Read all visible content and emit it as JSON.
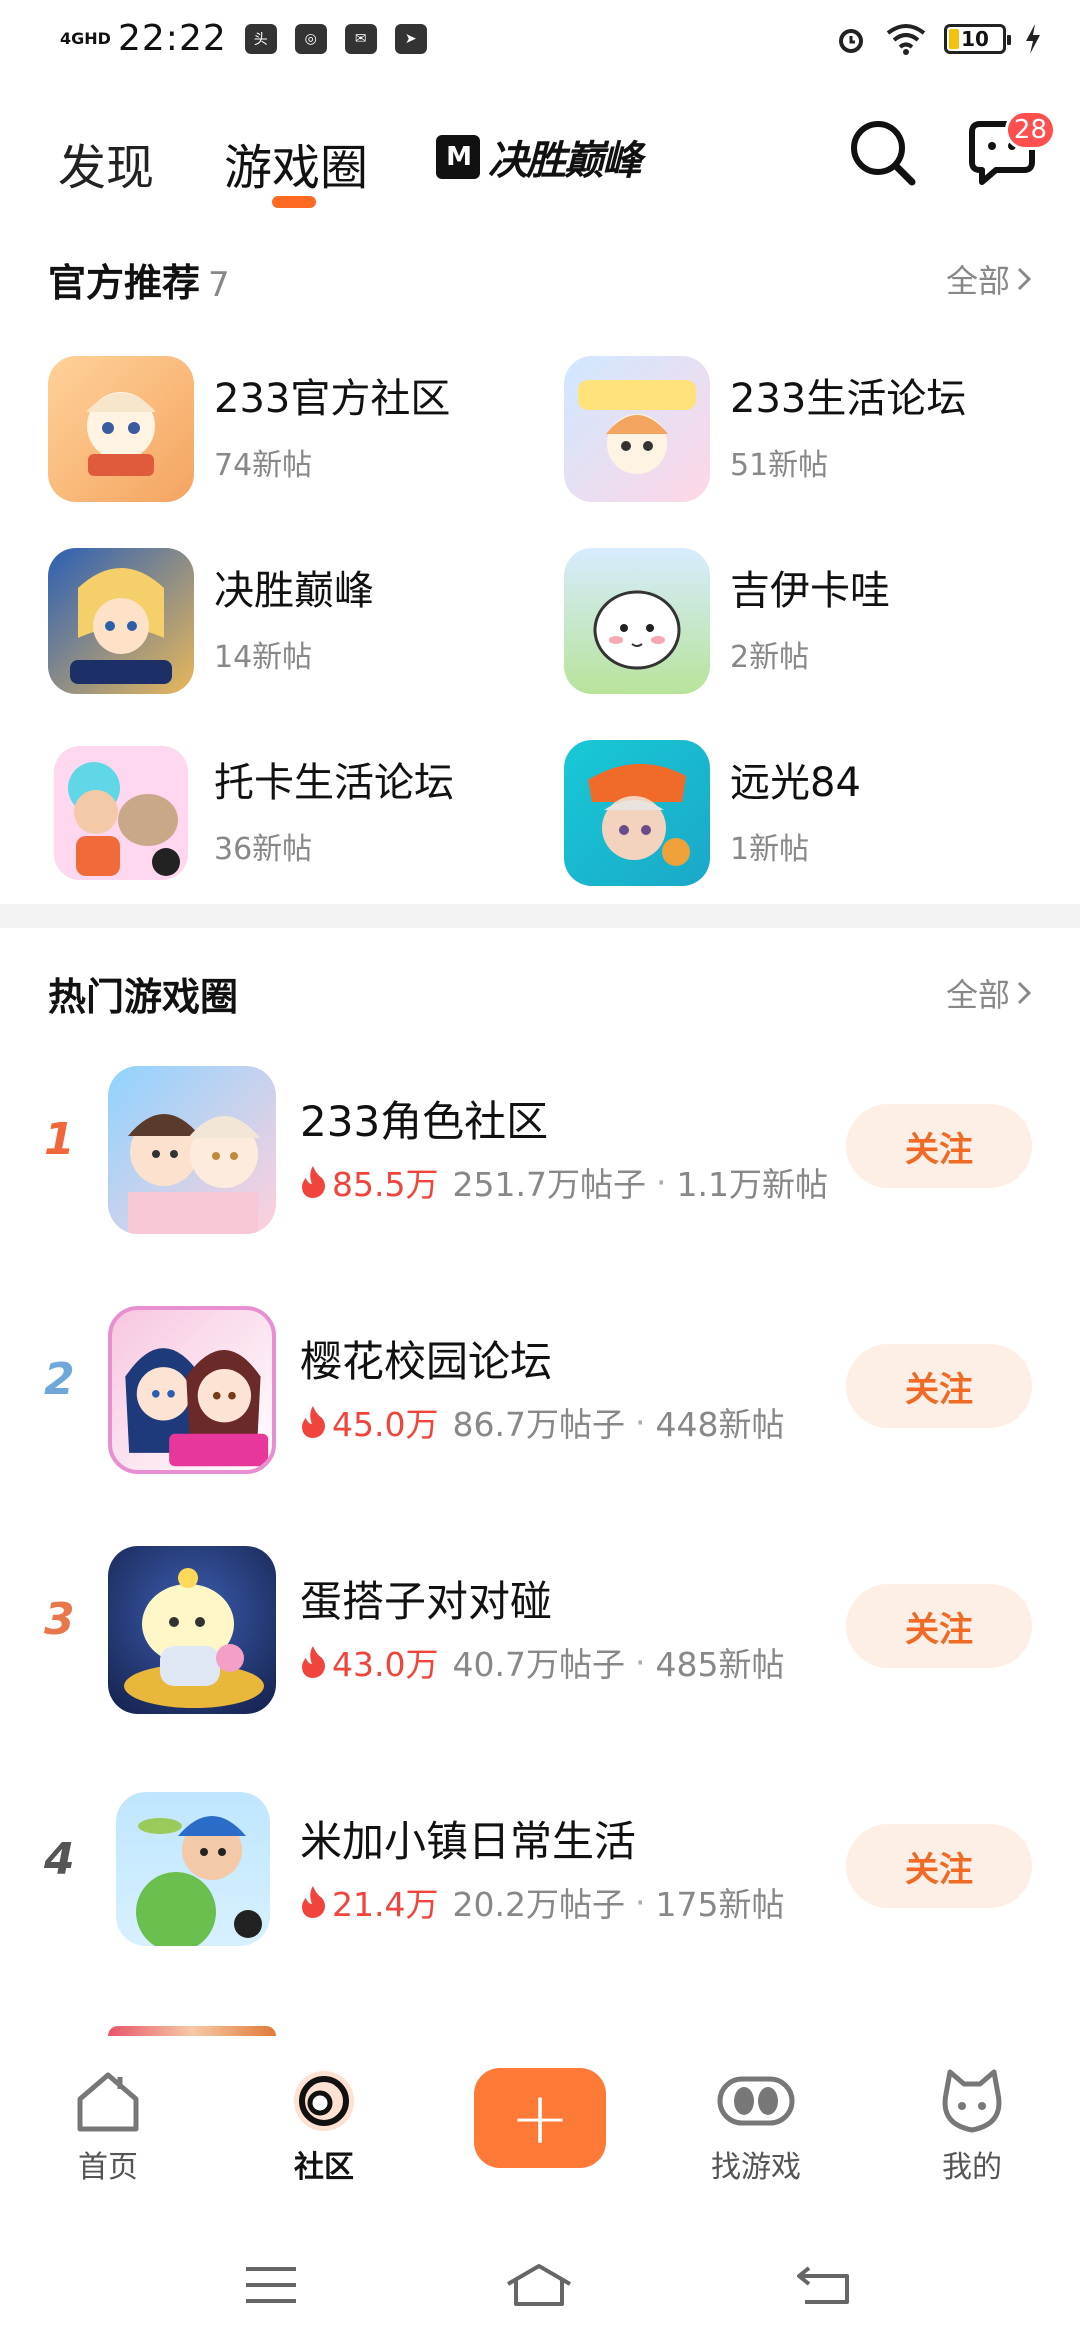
{
  "status_bar": {
    "network": "4GHD",
    "time": "22:22",
    "battery": "10",
    "mini_icons": [
      "toutiao-icon",
      "camera-icon",
      "mail-icon",
      "telegram-icon"
    ]
  },
  "header": {
    "tabs": [
      {
        "label": "发现"
      },
      {
        "label": "游戏圈"
      }
    ],
    "brand_tab": "决胜巅峰",
    "message_badge": "28"
  },
  "official": {
    "title": "官方推荐",
    "count": "7",
    "all_label": "全部",
    "items": [
      {
        "name": "233官方社区",
        "sub": "74新帖"
      },
      {
        "name": "233生活论坛",
        "sub": "51新帖"
      },
      {
        "name": "决胜巅峰",
        "sub": "14新帖"
      },
      {
        "name": "吉伊卡哇",
        "sub": "2新帖"
      },
      {
        "name": "托卡生活论坛",
        "sub": "36新帖"
      },
      {
        "name": "远光84",
        "sub": "1新帖"
      }
    ]
  },
  "hot": {
    "title": "热门游戏圈",
    "all_label": "全部",
    "follow_label": "关注",
    "items": [
      {
        "rank": "1",
        "name": "233角色社区",
        "heat": "85.5万",
        "posts": "251.7万帖子",
        "new": "1.1万新帖",
        "rank_color": "#f0683a"
      },
      {
        "rank": "2",
        "name": "樱花校园论坛",
        "heat": "45.0万",
        "posts": "86.7万帖子",
        "new": "448新帖",
        "rank_color": "#6fa8d8"
      },
      {
        "rank": "3",
        "name": "蛋搭子对对碰",
        "heat": "43.0万",
        "posts": "40.7万帖子",
        "new": "485新帖",
        "rank_color": "#e8784c"
      },
      {
        "rank": "4",
        "name": "米加小镇日常生活",
        "heat": "21.4万",
        "posts": "20.2万帖子",
        "new": "175新帖",
        "rank_color": "#555555"
      }
    ]
  },
  "bottom_nav": {
    "items": [
      {
        "label": "首页"
      },
      {
        "label": "社区"
      },
      {
        "label": "找游戏"
      },
      {
        "label": "我的"
      }
    ],
    "plus": "+"
  },
  "colors": {
    "accent": "#ff7a36",
    "follow_bg": "#fdeee6",
    "heat": "#f0443c"
  }
}
